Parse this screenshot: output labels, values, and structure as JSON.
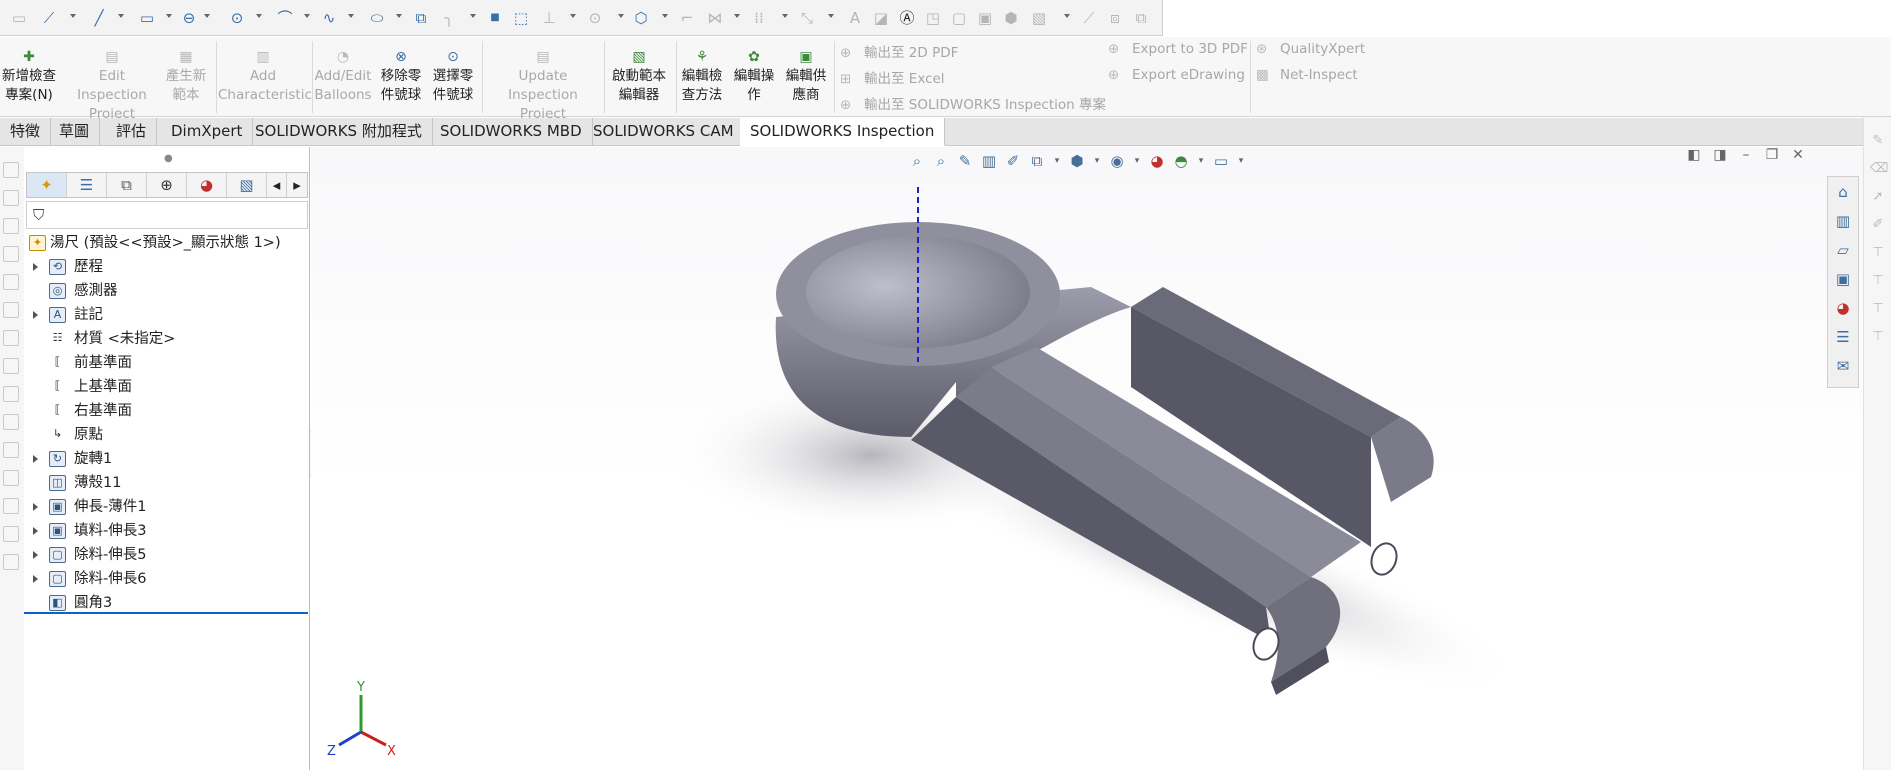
{
  "sketch_toolbar": {
    "icons": [
      "sketch-icon",
      "smart-dimension-icon",
      "line-icon",
      "rectangle-icon",
      "slot-icon",
      "circle-icon",
      "arc-icon",
      "spline-icon",
      "ellipse-icon",
      "3d-sketch-icon",
      "fillet-sketch-icon",
      "point-icon",
      "centerline-icon",
      "offset-icon",
      "polygon-icon",
      "convert-entities-icon",
      "trim-icon",
      "mirror-icon",
      "move-entities-icon",
      "text-icon",
      "dimension-icon",
      "relations-icon",
      "repair-icon",
      "quick-snaps-icon",
      "rapid-sketch-icon",
      "instant2d-icon",
      "shaded-sketch-icon"
    ]
  },
  "commands": {
    "new_project": {
      "line1": "新增檢查",
      "line2": "專案(N)"
    },
    "edit_project": {
      "line1": "Edit Inspection",
      "line2": "Project"
    },
    "gen_template": {
      "line1": "產生新",
      "line2": "範本"
    },
    "add_char": {
      "line1": "Add",
      "line2": "Characteristic"
    },
    "add_balloons": {
      "line1": "Add/Edit",
      "line2": "Balloons"
    },
    "remove_balloon": {
      "line1": "移除零",
      "line2": "件號球"
    },
    "select_balloon": {
      "line1": "選擇零",
      "line2": "件號球"
    },
    "update_project": {
      "line1": "Update Inspection",
      "line2": "Project"
    },
    "launch_template": {
      "line1": "啟動範本",
      "line2": "編輯器"
    },
    "edit_method": {
      "line1": "編輯檢",
      "line2": "查方法"
    },
    "edit_operation": {
      "line1": "編輯操",
      "line2": "作"
    },
    "edit_vendor": {
      "line1": "編輯供",
      "line2": "應商"
    },
    "export_2d": "輸出至 2D PDF",
    "export_excel": "輸出至 Excel",
    "export_sw": "輸出至 SOLIDWORKS Inspection 專案",
    "export_3d": "Export to 3D PDF",
    "export_edrawing": "Export eDrawing",
    "qualityxpert": "QualityXpert",
    "net_inspect": "Net-Inspect"
  },
  "tabs": [
    "特徵",
    "草圖",
    "評估",
    "DimXpert",
    "SOLIDWORKS 附加程式",
    "SOLIDWORKS MBD",
    "SOLIDWORKS CAM",
    "SOLIDWORKS Inspection"
  ],
  "active_tab": "SOLIDWORKS Inspection",
  "feature_tree": {
    "root": "湯尺  (預設<<預設>_顯示狀態 1>)",
    "items": [
      {
        "label": "歷程",
        "icon": "history-icon",
        "expandable": true
      },
      {
        "label": "感測器",
        "icon": "sensor-icon",
        "expandable": false
      },
      {
        "label": "註記",
        "icon": "annotation-icon",
        "expandable": true
      },
      {
        "label": "材質 <未指定>",
        "icon": "material-icon",
        "expandable": false
      },
      {
        "label": "前基準面",
        "icon": "plane-icon",
        "expandable": false
      },
      {
        "label": "上基準面",
        "icon": "plane-icon",
        "expandable": false
      },
      {
        "label": "右基準面",
        "icon": "plane-icon",
        "expandable": false
      },
      {
        "label": "原點",
        "icon": "origin-icon",
        "expandable": false
      },
      {
        "label": "旋轉1",
        "icon": "revolve-icon",
        "expandable": true
      },
      {
        "label": "薄殼11",
        "icon": "shell-icon",
        "expandable": false
      },
      {
        "label": "伸長-薄件1",
        "icon": "extrude-icon",
        "expandable": true
      },
      {
        "label": "填料-伸長3",
        "icon": "extrude-icon",
        "expandable": true
      },
      {
        "label": "除料-伸長5",
        "icon": "cut-extrude-icon",
        "expandable": true
      },
      {
        "label": "除料-伸長6",
        "icon": "cut-extrude-icon",
        "expandable": true
      },
      {
        "label": "圓角3",
        "icon": "fillet-icon",
        "expandable": false
      }
    ]
  },
  "triad": {
    "x": "X",
    "y": "Y",
    "z": "Z"
  },
  "colors": {
    "axis_blue": "#1a22c8",
    "model_grey": "#8e8e9c",
    "accent": "#0a64c8"
  }
}
